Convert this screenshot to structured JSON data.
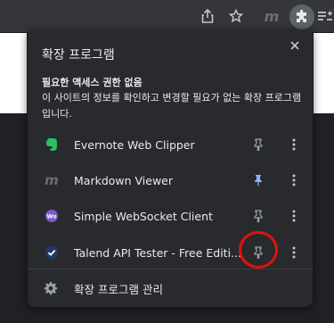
{
  "popup": {
    "title": "확장 프로그램",
    "section_heading": "필요한 액세스 권한 없음",
    "section_description": "이 사이트의 정보를 확인하고 변경할 필요가 없는 확장 프로그램입니다.",
    "extensions": [
      {
        "name": "Evernote Web Clipper",
        "icon": "evernote-icon",
        "pinned": false
      },
      {
        "name": "Markdown Viewer",
        "icon": "markdown-icon",
        "pinned": true
      },
      {
        "name": "Simple WebSocket Client",
        "icon": "websocket-icon",
        "pinned": false
      },
      {
        "name": "Talend API Tester - Free Editi...",
        "icon": "talend-icon",
        "pinned": false
      }
    ],
    "manage_label": "확장 프로그램 관리"
  },
  "colors": {
    "pinned": "#8ab4f8",
    "unpinned": "#9aa0a6",
    "highlight": "#e3120b"
  }
}
